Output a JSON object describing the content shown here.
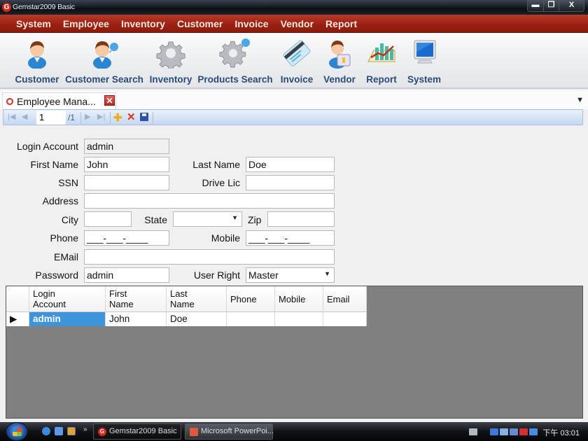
{
  "window": {
    "title": "Gemstar2009 Basic",
    "app_icon_letter": "G",
    "controls": {
      "minimize": "▬",
      "maximize": "❐",
      "close": "X"
    }
  },
  "menu": {
    "items": [
      "System",
      "Employee",
      "Inventory",
      "Customer",
      "Invoice",
      "Vendor",
      "Report"
    ]
  },
  "toolbar": {
    "items": [
      {
        "label": "Customer",
        "icon": "customer-icon"
      },
      {
        "label": "Customer Search",
        "icon": "customer-search-icon"
      },
      {
        "label": "Inventory",
        "icon": "gear-icon"
      },
      {
        "label": "Products Search",
        "icon": "products-search-icon"
      },
      {
        "label": "Invoice",
        "icon": "invoice-card-icon"
      },
      {
        "label": "Vendor",
        "icon": "vendor-icon"
      },
      {
        "label": "Report",
        "icon": "report-chart-icon"
      },
      {
        "label": "System",
        "icon": "monitor-icon"
      }
    ]
  },
  "tabs": {
    "active_label": "Employee  Mana...",
    "close_glyph": "✕",
    "overflow_glyph": "▼"
  },
  "navigator": {
    "first": "|◀",
    "prev": "◀",
    "position": "1",
    "count": "/1",
    "next": "▶",
    "last": "▶|",
    "add": "✚",
    "delete": "✕"
  },
  "form": {
    "login_account": {
      "label": "Login Account",
      "value": "admin"
    },
    "first_name": {
      "label": "First Name",
      "value": "John"
    },
    "last_name": {
      "label": "Last Name",
      "value": "Doe"
    },
    "ssn": {
      "label": "SSN",
      "value": ""
    },
    "drive_lic": {
      "label": "Drive Lic",
      "value": ""
    },
    "address": {
      "label": "Address",
      "value": ""
    },
    "city": {
      "label": "City",
      "value": ""
    },
    "state": {
      "label": "State",
      "value": ""
    },
    "zip": {
      "label": "Zip",
      "value": ""
    },
    "phone": {
      "label": "Phone",
      "value": "___-___-____"
    },
    "mobile": {
      "label": "Mobile",
      "value": "___-___-____"
    },
    "email": {
      "label": "EMail",
      "value": ""
    },
    "password": {
      "label": "Password",
      "value": "admin"
    },
    "user_right": {
      "label": "User Right",
      "value": "Master"
    },
    "caret_glyph": "▼"
  },
  "grid": {
    "columns": [
      "Login\nAccount",
      "First\nName",
      "Last\nName",
      "Phone",
      "Mobile",
      "Email"
    ],
    "column_lines": [
      [
        "Login",
        "Account"
      ],
      [
        "First",
        "Name"
      ],
      [
        "Last",
        "Name"
      ],
      [
        "Phone"
      ],
      [
        "Mobile"
      ],
      [
        "Email"
      ]
    ],
    "rows": [
      {
        "indicator": "▶",
        "login_account": "admin",
        "first_name": "John",
        "last_name": "Doe",
        "phone": "",
        "mobile": "",
        "email": ""
      }
    ]
  },
  "taskbar": {
    "more_glyph": "»",
    "tasks": [
      {
        "label": "Gemstar2009 Basic",
        "active": true
      },
      {
        "label": "Microsoft PowerPoi...",
        "active": false
      }
    ],
    "clock": "下午 03:01"
  },
  "colors": {
    "menu_bar": "#9b2112",
    "toolbar_label": "#2c4a78",
    "selection": "#3e94d8",
    "grid_background": "#808080"
  }
}
